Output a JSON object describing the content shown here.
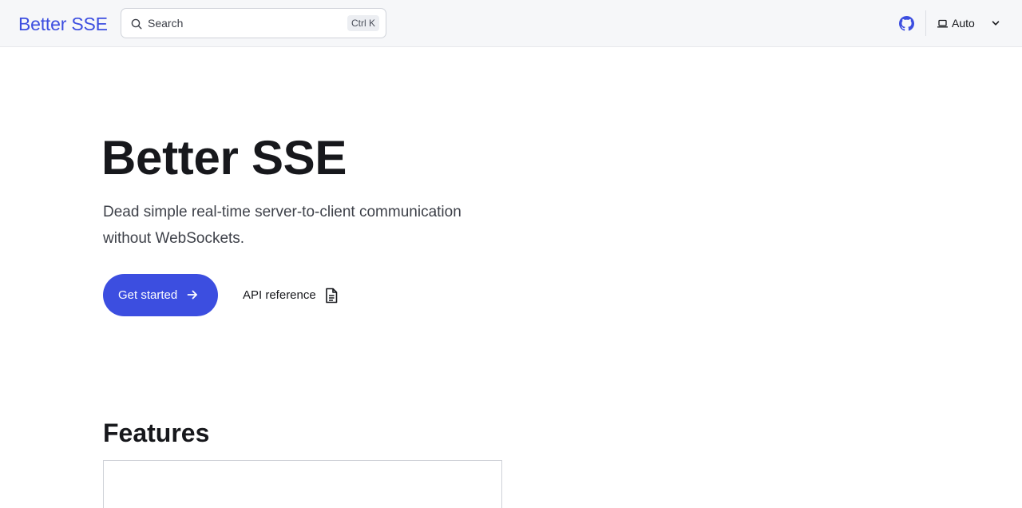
{
  "nav": {
    "brand": "Better SSE",
    "search_placeholder": "Search",
    "search_shortcut": "Ctrl K",
    "github_icon": "github-icon",
    "theme_label": "Auto"
  },
  "hero": {
    "title": "Better SSE",
    "tagline": "Dead simple real-time server-to-client communication without WebSockets.",
    "primary_cta": "Get started",
    "secondary_cta": "API reference"
  },
  "features": {
    "title": "Features"
  },
  "colors": {
    "accent": "#3c4ee0",
    "topbar_bg": "#f6f7f9",
    "text": "#17181c"
  }
}
